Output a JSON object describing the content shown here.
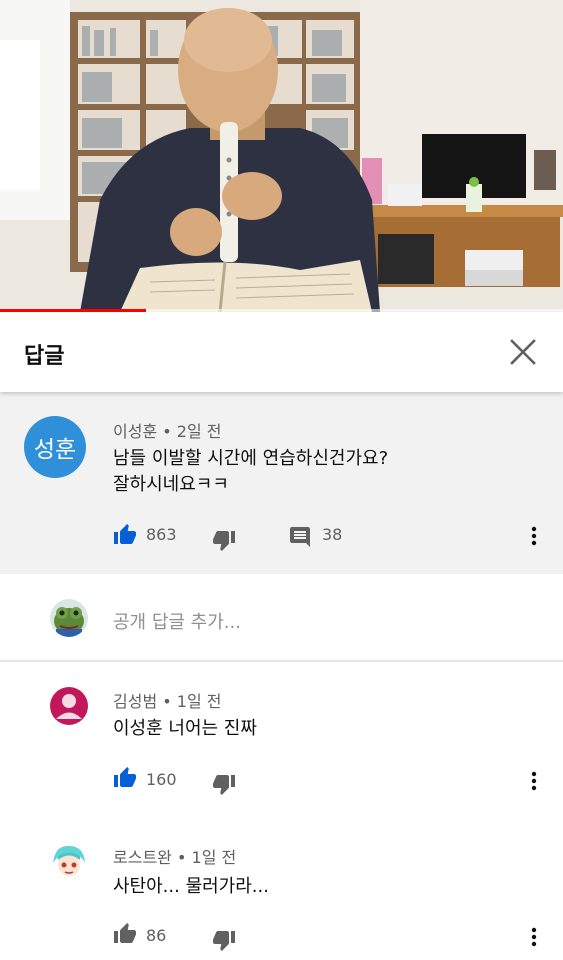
{
  "video": {
    "progress_fraction": 0.26
  },
  "panel": {
    "title": "답글"
  },
  "parent_comment": {
    "avatar_text": "성훈",
    "avatar_color": "#2f8fd8",
    "author": "이성훈",
    "time": "2일 전",
    "separator": "•",
    "text_line1": "남들 이발할 시간에 연습하신건가요?",
    "text_line2": "잘하시네요ㅋㅋ",
    "likes": "863",
    "replies": "38"
  },
  "reply_input": {
    "placeholder": "공개 답글 추가..."
  },
  "replies": [
    {
      "author": "김성범",
      "time": "1일 전",
      "separator": "•",
      "text": "이성훈 너어는 진짜",
      "likes": "160",
      "avatar_color": "#c2185b"
    },
    {
      "author": "로스트완",
      "time": "1일 전",
      "separator": "•",
      "text": "사탄아... 물러가라...",
      "likes": "86",
      "avatar_color": "#5fd4d6"
    }
  ],
  "colors": {
    "accent_red": "#ff0000",
    "like_blue": "#065fd4",
    "icon_gray": "#606060"
  }
}
